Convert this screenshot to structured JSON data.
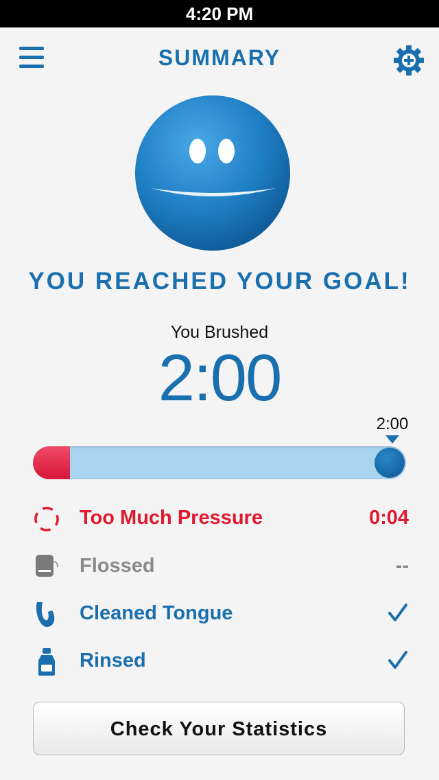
{
  "status_bar": {
    "time": "4:20 PM"
  },
  "nav": {
    "title": "SUMMARY"
  },
  "summary": {
    "goal_message": "YOU REACHED YOUR GOAL!",
    "brushed_label": "You Brushed",
    "brushed_time": "2:00"
  },
  "progress": {
    "marker_label": "2:00",
    "pressure_fraction": 0.1,
    "completion_fraction": 1.0
  },
  "stats": [
    {
      "label": "Too Much Pressure",
      "value": "0:04",
      "icon": "pressure-icon",
      "color": "#e0192f"
    },
    {
      "label": "Flossed",
      "value": "--",
      "icon": "floss-icon",
      "color": "#8a8a8a"
    },
    {
      "label": "Cleaned Tongue",
      "value": "✓",
      "icon": "tongue-icon",
      "color": "#1a6fae"
    },
    {
      "label": "Rinsed",
      "value": "✓",
      "icon": "rinse-bottle-icon",
      "color": "#1a6fae"
    }
  ],
  "actions": {
    "statistics_button": "Check Your Statistics"
  },
  "colors": {
    "brand_blue": "#1a6fae",
    "alert_red": "#e0192f",
    "muted_gray": "#8a8a8a",
    "progress_track": "#a8d4ef"
  }
}
